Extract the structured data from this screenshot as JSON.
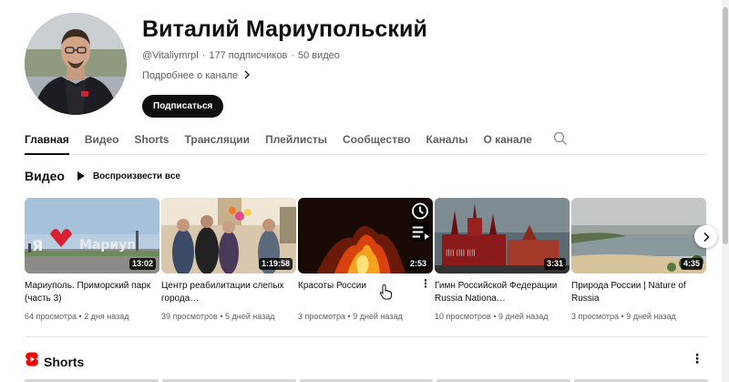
{
  "channel": {
    "name": "Виталий Мариупольский",
    "handle": "@Vitaliymrpl",
    "subscribers": "177 подписчиков",
    "video_count": "50 видео",
    "about_label": "Подробнее о канале",
    "subscribe_label": "Подписаться"
  },
  "tabs": [
    {
      "label": "Главная",
      "active": true
    },
    {
      "label": "Видео"
    },
    {
      "label": "Shorts"
    },
    {
      "label": "Трансляции"
    },
    {
      "label": "Плейлисты"
    },
    {
      "label": "Сообщество"
    },
    {
      "label": "Каналы"
    },
    {
      "label": "О канале"
    }
  ],
  "videos_section": {
    "title": "Видео",
    "play_all_label": "Воспроизвести все",
    "items": [
      {
        "title": "Мариуполь. Приморский парк (часть 3)",
        "duration": "13:02",
        "views": "64 просмотра",
        "age": "2 дня назад"
      },
      {
        "title": "Центр реабилитации слепых города…",
        "duration": "1:19:58",
        "views": "39 просмотров",
        "age": "5 дней назад"
      },
      {
        "title": "Красоты России",
        "duration": "2:53",
        "views": "3 просмотра",
        "age": "9 дней назад"
      },
      {
        "title": "Гимн Российской Федерации Russia Nationa…",
        "duration": "3:31",
        "views": "10 просмотров",
        "age": "9 дней назад"
      },
      {
        "title": "Природа России | Nature of Russia",
        "duration": "4:35",
        "views": "3 просмотра",
        "age": "9 дней назад"
      }
    ]
  },
  "shorts_section": {
    "title": "Shorts"
  },
  "icons": {
    "search": "search-icon",
    "about_chevron": "chevron-right-icon",
    "play_all": "play-icon",
    "next": "chevron-right-icon",
    "more": "more-vert-icon",
    "watch_later": "clock-icon",
    "add_queue": "queue-icon",
    "shorts_logo": "shorts-logo-icon"
  },
  "colors": {
    "text_primary": "#0f0f0f",
    "text_secondary": "#606060",
    "subscribe_bg": "#0f0f0f",
    "shorts_red": "#ff0000"
  }
}
